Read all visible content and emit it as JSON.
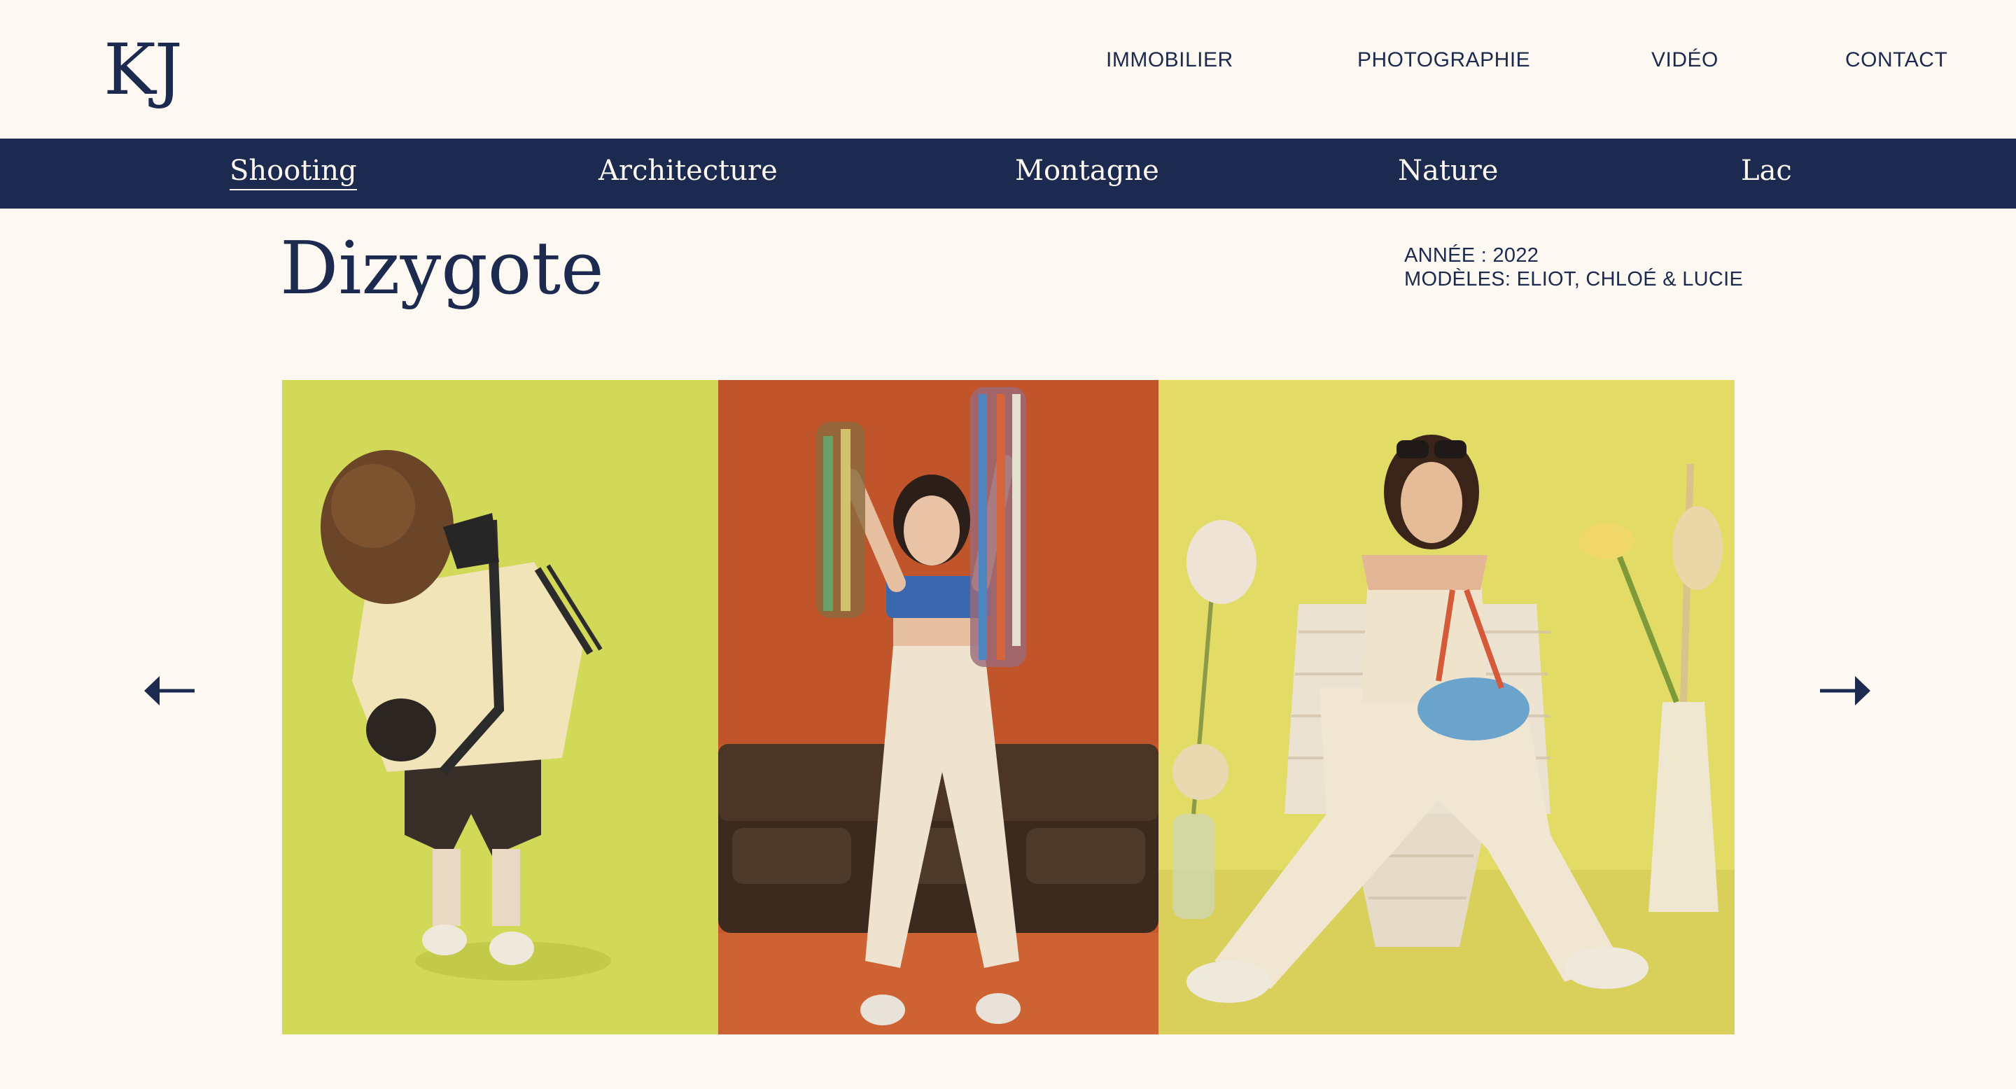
{
  "header": {
    "logo": "KJ",
    "nav": [
      {
        "label": "IMMOBILIER"
      },
      {
        "label": "PHOTOGRAPHIE"
      },
      {
        "label": "VIDÉO"
      },
      {
        "label": "CONTACT"
      }
    ]
  },
  "categories": [
    {
      "label": "Shooting",
      "active": true
    },
    {
      "label": "Architecture",
      "active": false
    },
    {
      "label": "Montagne",
      "active": false
    },
    {
      "label": "Nature",
      "active": false
    },
    {
      "label": "Lac",
      "active": false
    }
  ],
  "project": {
    "title": "Dizygote",
    "year_line": "ANNÉE : 2022",
    "models_line": "MODÈLES: ELIOT, CHLOÉ & LUCIE"
  },
  "gallery": {
    "photos": [
      {
        "background": "#d8dc5c",
        "icon": "photo-model-eliot"
      },
      {
        "background": "#c65a2e",
        "icon": "photo-model-chloe"
      },
      {
        "background": "#e2db66",
        "icon": "photo-model-lucie"
      }
    ]
  },
  "colors": {
    "navy": "#1b2a4e",
    "cream": "#fdf9f2"
  },
  "controls": {
    "prev_icon": "arrow-left-icon",
    "next_icon": "arrow-right-icon"
  }
}
